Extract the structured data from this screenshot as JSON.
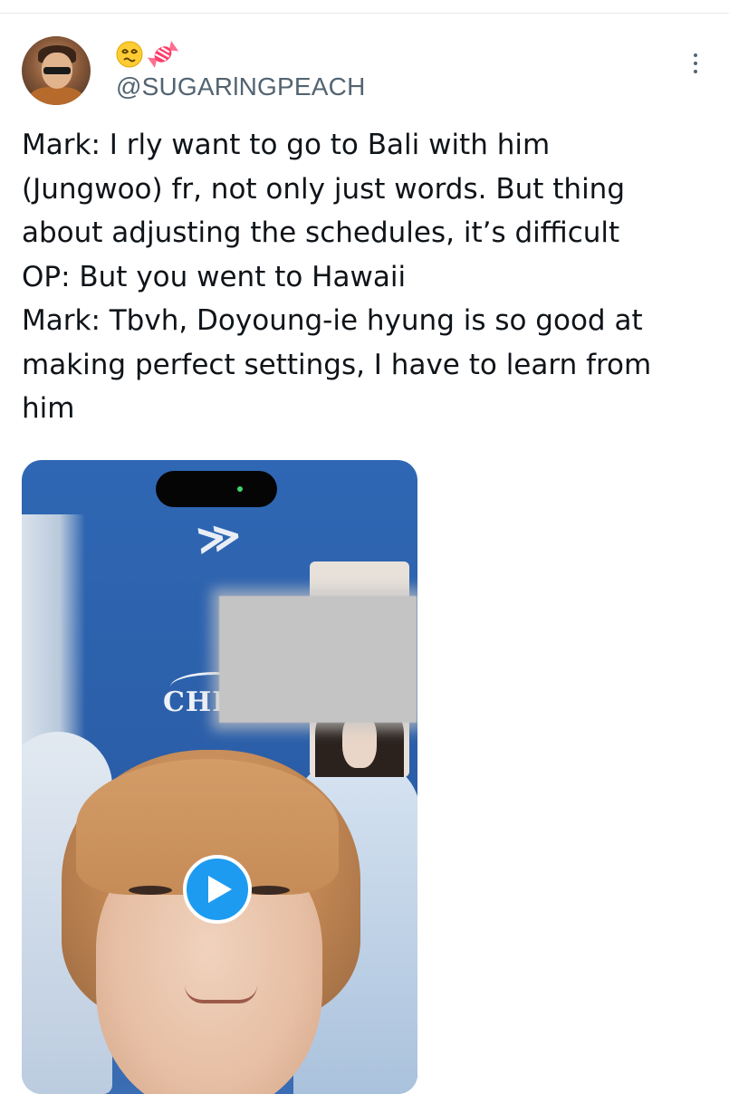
{
  "tweet": {
    "display_name_emojis": [
      "dizzy-face-emoji",
      "candy-emoji"
    ],
    "username": "@SUGARlNGPEACH",
    "lines": [
      "Mark: I rly want to go to Bali with him",
      "(Jungwoo) fr, not only just words. But thing",
      "about adjusting the schedules, it’s difficult",
      "OP: But you went to Hawaii",
      "Mark:  Tbvh, Doyoung-ie hyung is so good at",
      "making perfect settings, I have to learn from",
      "him"
    ]
  },
  "media": {
    "type": "video",
    "overlay_text": "CHIL",
    "play_icon": "play-icon"
  },
  "icons": {
    "more": "more-vertical-icon"
  },
  "colors": {
    "accent": "#1d9bf0",
    "text_primary": "#0f1419",
    "text_secondary": "#536471"
  }
}
